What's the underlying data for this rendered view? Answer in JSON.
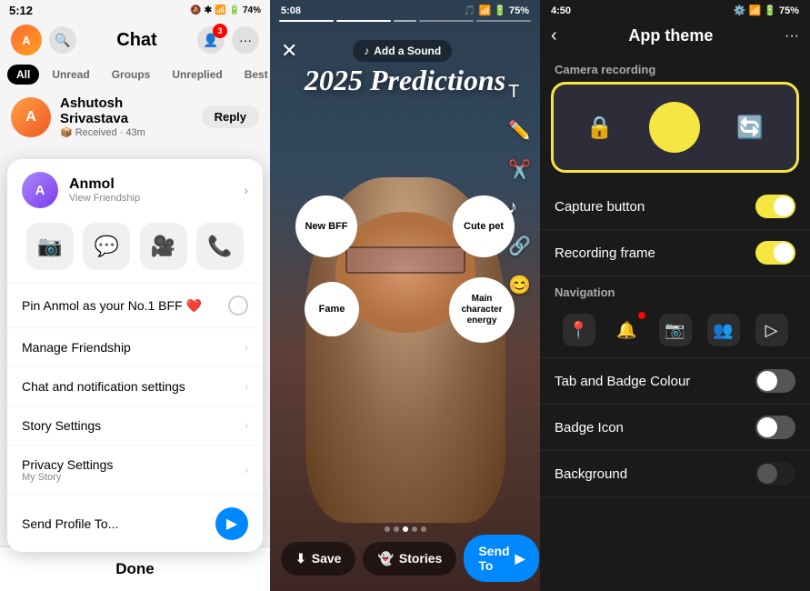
{
  "panel1": {
    "status": {
      "time": "5:12",
      "icons": "🔕 ✱ 🔵 📶 📶 🔋 74%"
    },
    "header": {
      "title": "Chat",
      "add_friend_badge": "3"
    },
    "filters": [
      "All",
      "Unread",
      "Groups",
      "Unreplied",
      "Best Fri..."
    ],
    "active_filter": "All",
    "chat_item": {
      "name": "Ashutosh Srivastava",
      "status": "Received · 43m",
      "reply_label": "Reply"
    },
    "context_menu": {
      "user_name": "Anmol",
      "view_friendship": "View Friendship",
      "actions": [
        "📷",
        "💬",
        "🎥",
        "📞"
      ],
      "pin_label": "Pin Anmol as your No.1 BFF ❤️",
      "manage_friendship": "Manage Friendship",
      "chat_notifications": "Chat and notification settings",
      "story_settings": "Story Settings",
      "privacy_settings": "Privacy Settings",
      "privacy_sub": "My Story",
      "send_profile": "Send Profile To...",
      "done_label": "Done"
    }
  },
  "panel2": {
    "status": {
      "time": "5:08",
      "icons": "🎵 ✱ 🔵 📶 📶 🔋 75%"
    },
    "add_sound": "Add a Sound",
    "story_title": "2025 Predictions",
    "bubbles": [
      {
        "label": "New BFF",
        "x": 30,
        "y": 20,
        "size": 68
      },
      {
        "label": "Cute pet",
        "x": 65,
        "y": 20,
        "size": 68
      },
      {
        "label": "Fame",
        "x": 22,
        "y": 52,
        "size": 60
      },
      {
        "label": "Main character energy",
        "x": 62,
        "y": 50,
        "size": 72
      }
    ],
    "bottom": {
      "save": "Save",
      "stories": "Stories",
      "send_to": "Send To"
    }
  },
  "panel3": {
    "status": {
      "time": "4:50",
      "icons": "⚙️ ✱ 🔵 📶 📶 🔋 75%"
    },
    "header": {
      "back": "‹",
      "title": "App theme",
      "more": "···"
    },
    "camera_recording_label": "Camera recording",
    "settings": [
      {
        "label": "Capture button",
        "toggle": "on"
      },
      {
        "label": "Recording frame",
        "toggle": "on"
      },
      {
        "label": "Tab and Badge Colour",
        "toggle": "off"
      },
      {
        "label": "Badge Icon",
        "toggle": "off"
      },
      {
        "label": "Background",
        "toggle": "off"
      }
    ],
    "navigation_label": "Navigation",
    "nav_icons": [
      "📍",
      "🔔",
      "📷",
      "👥",
      "▷"
    ]
  }
}
